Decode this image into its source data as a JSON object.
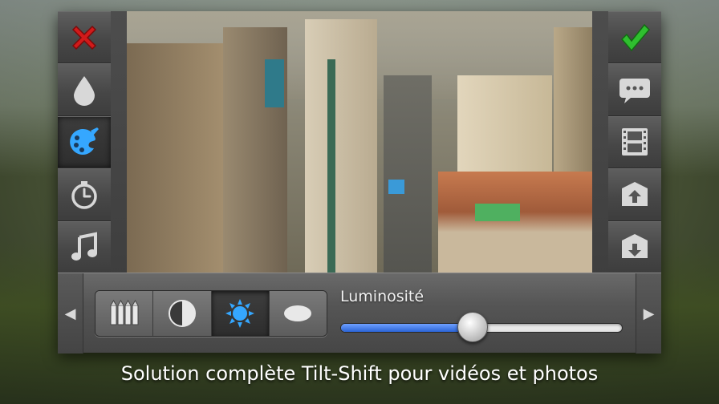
{
  "left_toolbar": {
    "items": [
      {
        "icon": "close-x-icon",
        "color": "#d11a1a"
      },
      {
        "icon": "drop-icon"
      },
      {
        "icon": "palette-brush-icon",
        "color": "#35a7ff",
        "active": true
      },
      {
        "icon": "timer-icon"
      },
      {
        "icon": "music-note-icon"
      }
    ]
  },
  "right_toolbar": {
    "items": [
      {
        "icon": "checkmark-icon",
        "color": "#2fbf2f"
      },
      {
        "icon": "speech-bubble-icon"
      },
      {
        "icon": "film-strip-icon"
      },
      {
        "icon": "box-export-icon"
      },
      {
        "icon": "box-import-icon"
      }
    ]
  },
  "bottom_toolbar": {
    "prev_arrow": "◀",
    "next_arrow": "▶",
    "segments": [
      {
        "icon": "pencils-icon"
      },
      {
        "icon": "contrast-icon"
      },
      {
        "icon": "sun-icon",
        "color": "#35a7ff",
        "active": true
      },
      {
        "icon": "ellipse-icon"
      }
    ],
    "slider": {
      "label": "Luminosité",
      "value": 0.47,
      "fill_color": "#2b64d6"
    }
  },
  "caption": "Solution complète Tilt-Shift pour vidéos et photos"
}
